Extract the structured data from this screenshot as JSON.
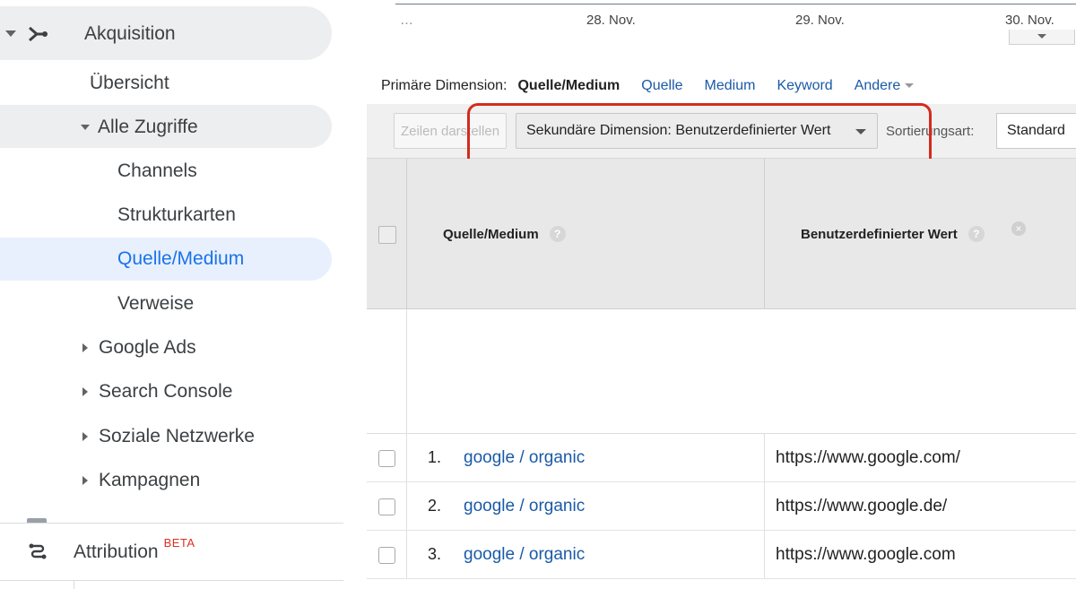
{
  "sidebar": {
    "akquisition": "Akquisition",
    "uebersicht": "Übersicht",
    "alle_zugriffe": "Alle Zugriffe",
    "channels": "Channels",
    "strukturkarten": "Strukturkarten",
    "quelle_medium": "Quelle/Medium",
    "verweise": "Verweise",
    "google_ads": "Google Ads",
    "search_console": "Search Console",
    "soziale_netzwerke": "Soziale Netzwerke",
    "kampagnen": "Kampagnen",
    "attribution": "Attribution",
    "beta_badge": "BETA"
  },
  "chart_axis": {
    "ellipsis": "…",
    "labels": [
      "28. Nov.",
      "29. Nov.",
      "30. Nov."
    ]
  },
  "dimensions": {
    "label": "Primäre Dimension:",
    "current": "Quelle/Medium",
    "links": [
      "Quelle",
      "Medium",
      "Keyword"
    ],
    "other": "Andere"
  },
  "toolbar": {
    "rows_button": "Zeilen darstellen",
    "secondary_dimension": "Sekundäre Dimension: Benutzerdefinierter Wert",
    "sort_label": "Sortierungsart:",
    "sort_value": "Standard"
  },
  "table": {
    "col_source": "Quelle/Medium",
    "col_custom": "Benutzerdefinierter Wert",
    "help_glyph": "?",
    "remove_glyph": "×",
    "rows": [
      {
        "num": "1.",
        "source": "google / organic",
        "value": "https://www.google.com/"
      },
      {
        "num": "2.",
        "source": "google / organic",
        "value": "https://www.google.de/"
      },
      {
        "num": "3.",
        "source": "google / organic",
        "value": "https://www.google.com"
      }
    ]
  },
  "colors": {
    "accent": "#1a73e8",
    "link": "#1a5aa6",
    "highlight": "#d42a1e"
  }
}
